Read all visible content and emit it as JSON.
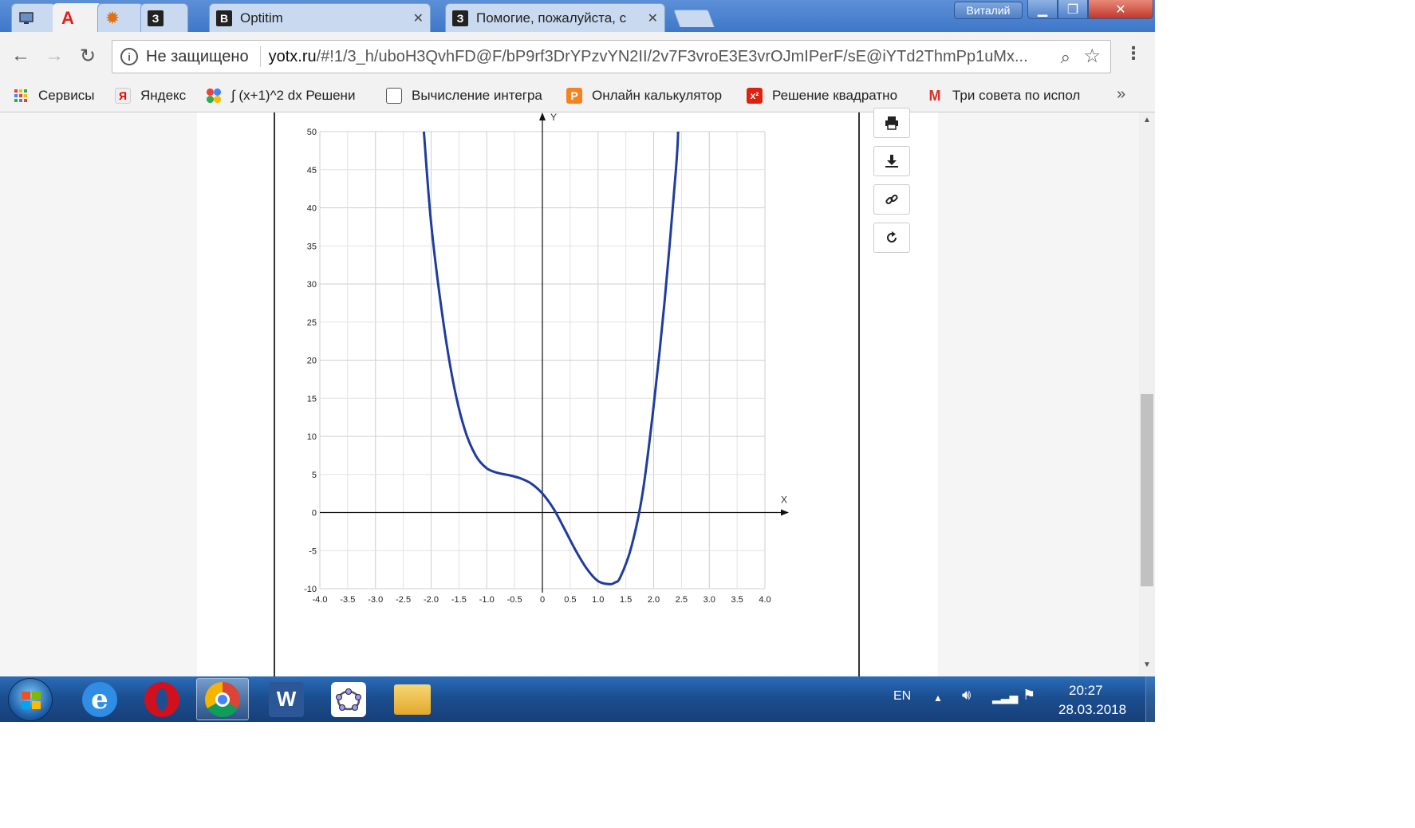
{
  "browser": {
    "tabs": [
      {
        "title": "",
        "icon": "screen-icon",
        "active": false
      },
      {
        "title": "",
        "icon": "alpha-logo-icon",
        "active": true
      },
      {
        "title": "",
        "icon": "sun-icon",
        "active": false
      },
      {
        "title": "",
        "icon": "z-logo-icon",
        "active": false
      },
      {
        "title": "Optitim",
        "icon": "b-logo-icon",
        "active": false
      },
      {
        "title": "Помогие, пожалуйста, с",
        "icon": "z-logo-icon",
        "active": false
      }
    ],
    "profile_name": "Виталий",
    "security_label": "Не защищено",
    "url_host": "yotx.ru",
    "url_path": "/#!1/3_h/uboH3QvhFD@F/bP9rf3DrYPzvYN2II/2v7F3vroE3E3vrOJmIPerF/sE@iYTd2ThmPp1uMx..."
  },
  "bookmarks": [
    {
      "label": "Сервисы",
      "icon": "apps-grid-icon"
    },
    {
      "label": "Яндекс",
      "icon": "yandex-icon"
    },
    {
      "label": "∫ (x+1)^2 dx Решени",
      "icon": "google-dots-icon"
    },
    {
      "label": "Вычисление интегра",
      "icon": "page-icon"
    },
    {
      "label": "Онлайн калькулятор",
      "icon": "calc-icon"
    },
    {
      "label": "Решение квадратно",
      "icon": "x2-icon"
    },
    {
      "label": "Три совета по испол",
      "icon": "gmail-icon"
    }
  ],
  "bookmarks_more": "»",
  "chart_data": {
    "type": "line",
    "title": "",
    "xlabel": "X",
    "ylabel": "Y",
    "xlim": [
      -4.0,
      4.0
    ],
    "ylim": [
      -10,
      50
    ],
    "x_ticks": [
      "-4.0",
      "-3.5",
      "-3.0",
      "-2.5",
      "-2.0",
      "-1.5",
      "-1.0",
      "-0.5",
      "0",
      "0.5",
      "1.0",
      "1.5",
      "2.0",
      "2.5",
      "3.0",
      "3.5",
      "4.0"
    ],
    "y_ticks": [
      "-10",
      "-5",
      "0",
      "5",
      "10",
      "15",
      "20",
      "25",
      "30",
      "35",
      "40",
      "45",
      "50"
    ],
    "grid": true,
    "line_color": "#1f3c9e",
    "series": [
      {
        "x": [
          -2.13,
          -2.0,
          -1.8,
          -1.6,
          -1.4,
          -1.2,
          -1.0,
          -0.8,
          -0.6,
          -0.4,
          -0.2,
          0.0,
          0.2,
          0.4,
          0.6,
          0.8,
          1.0,
          1.2,
          1.3,
          1.4,
          1.6,
          1.8,
          2.0,
          2.2,
          2.4,
          2.44
        ],
        "y": [
          50,
          38,
          26,
          17,
          11,
          7.5,
          5.8,
          5.2,
          4.9,
          4.5,
          3.8,
          2.5,
          0.5,
          -2.2,
          -5.0,
          -7.4,
          -9.0,
          -9.4,
          -9.2,
          -8.5,
          -4.5,
          2.5,
          14,
          28,
          45,
          50
        ]
      }
    ]
  },
  "side_tools": [
    "print-icon",
    "download-icon",
    "link-icon",
    "share-icon"
  ],
  "taskbar": {
    "apps": [
      "ie-icon",
      "opera-icon",
      "chrome-icon",
      "word-icon",
      "geogebra-icon",
      "explorer-icon"
    ],
    "language": "EN",
    "time": "20:27",
    "date": "28.03.2018"
  }
}
